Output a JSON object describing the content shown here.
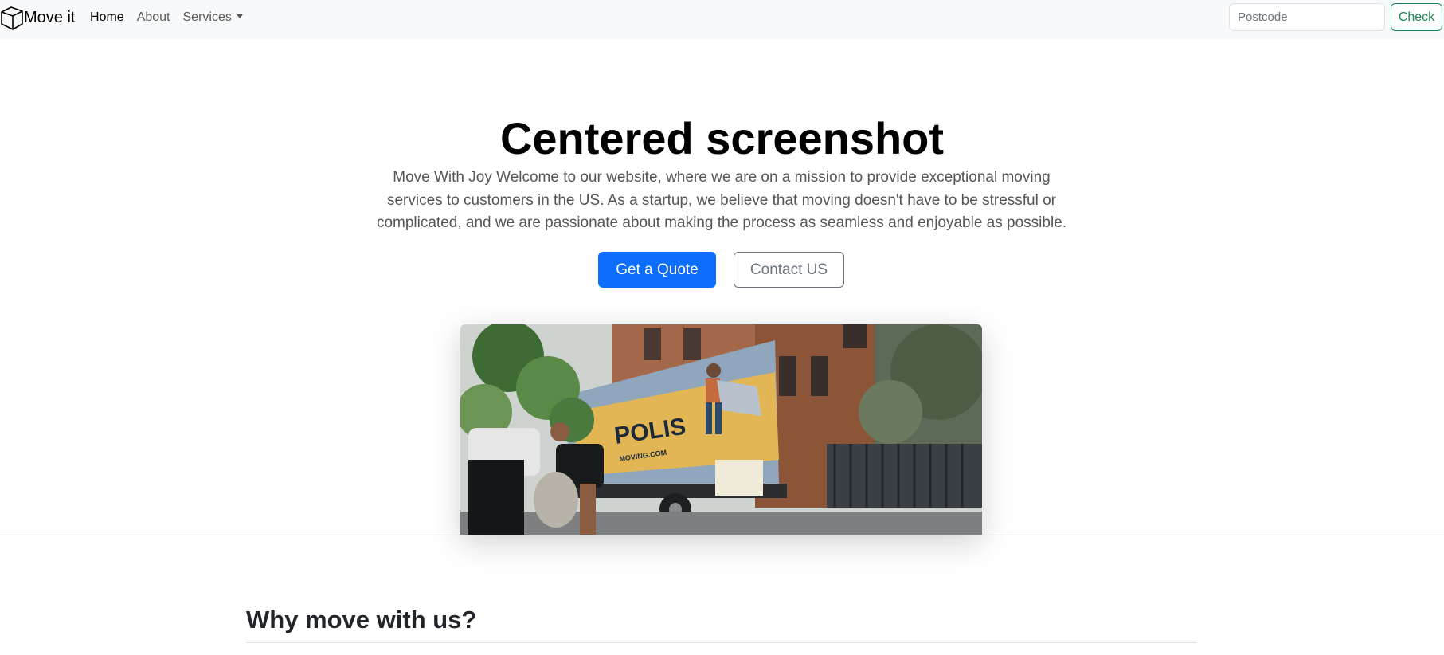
{
  "navbar": {
    "brand": "Move it",
    "links": [
      {
        "label": "Home"
      },
      {
        "label": "About"
      },
      {
        "label": "Services"
      }
    ],
    "search": {
      "placeholder": "Postcode",
      "value": ""
    },
    "check_label": "Check"
  },
  "hero": {
    "title": "Centered screenshot",
    "lead": "Move With Joy Welcome to our website, where we are on a mission to provide exceptional moving services to customers in the US. As a startup, we believe that moving doesn't have to be stressful or complicated, and we are passionate about making the process as seamless and enjoyable as possible.",
    "primary_button": "Get a Quote",
    "secondary_button": "Contact US",
    "image_truck_text": "POLIS",
    "image_truck_url": "MOVING.COM"
  },
  "section": {
    "title": "Why move with us?"
  },
  "colors": {
    "primary": "#0d6efd",
    "success": "#198754",
    "navbar_bg": "#f8f9fa"
  }
}
